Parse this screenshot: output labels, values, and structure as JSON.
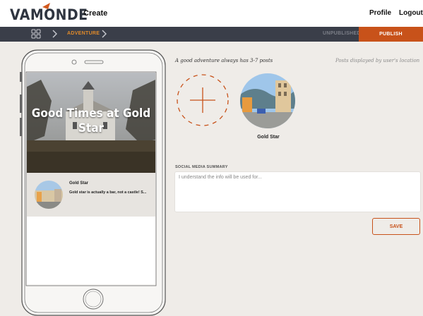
{
  "header": {
    "logo": "VAMONDE",
    "create_label": "Create",
    "profile_label": "Profile",
    "logout_label": "Logout"
  },
  "nav": {
    "breadcrumb": "ADVENTURE",
    "unpublished_label": "UNPUBLISHED",
    "publish_label": "PUBLISH"
  },
  "phone_preview": {
    "hero_title": "Good Times at Gold Star",
    "post": {
      "title": "Gold Star",
      "description": "Gold star is actually a bar, not a castle! S..."
    }
  },
  "editor": {
    "tip": "A good adventure always has 3-7 posts",
    "location_note": "Posts displayed by user's location",
    "posts": [
      {
        "label": "Gold Star"
      }
    ],
    "social_summary_label": "SOCIAL MEDIA SUMMARY",
    "social_summary_placeholder": "I understand the info will be used for...",
    "save_label": "SAVE"
  },
  "colors": {
    "accent": "#c8521a",
    "nav_bg": "#3a3e49",
    "breadcrumb": "#e08a2a",
    "page_bg": "#efece8"
  }
}
